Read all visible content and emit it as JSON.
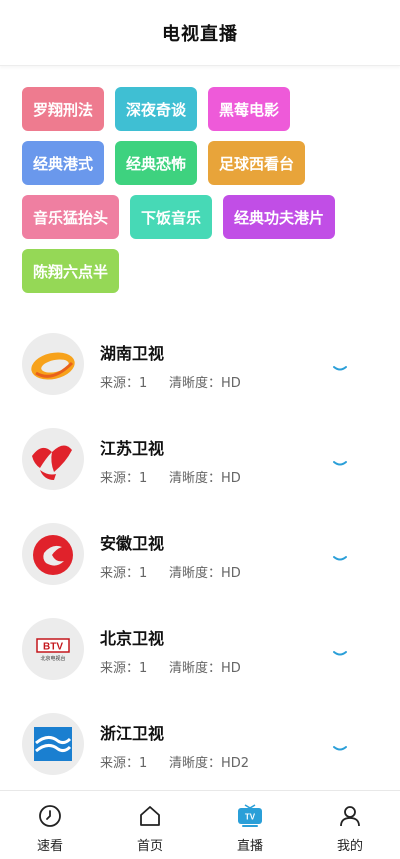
{
  "header": {
    "title": "电视直播"
  },
  "tags": [
    {
      "label": "罗翔刑法",
      "color": "#ee7b8f"
    },
    {
      "label": "深夜奇谈",
      "color": "#3fbfd3"
    },
    {
      "label": "黑莓电影",
      "color": "#ee5ad9"
    },
    {
      "label": "经典港式",
      "color": "#6a98ec"
    },
    {
      "label": "经典恐怖",
      "color": "#3ed27f"
    },
    {
      "label": "足球西看台",
      "color": "#e8a43a"
    },
    {
      "label": "音乐猛抬头",
      "color": "#ef7fa1"
    },
    {
      "label": "下饭音乐",
      "color": "#47d9b6"
    },
    {
      "label": "经典功夫港片",
      "color": "#c14ee6"
    },
    {
      "label": "陈翔六点半",
      "color": "#95d856"
    }
  ],
  "channels": [
    {
      "name": "湖南卫视",
      "source": "来源：1",
      "clarity": "清晰度：HD",
      "logo": "hunan-logo-icon"
    },
    {
      "name": "江苏卫视",
      "source": "来源：1",
      "clarity": "清晰度：HD",
      "logo": "jiangsu-logo-icon"
    },
    {
      "name": "安徽卫视",
      "source": "来源：1",
      "clarity": "清晰度：HD",
      "logo": "anhui-logo-icon"
    },
    {
      "name": "北京卫视",
      "source": "来源：1",
      "clarity": "清晰度：HD",
      "logo": "btv-logo-icon",
      "logo_text": "BTV",
      "logo_subtext": "北京电视台"
    },
    {
      "name": "浙江卫视",
      "source": "来源：1",
      "clarity": "清晰度：HD2",
      "logo": "zhejiang-logo-icon"
    }
  ],
  "tabbar": {
    "tabs": [
      {
        "label": "速看",
        "icon": "clock-icon"
      },
      {
        "label": "首页",
        "icon": "home-icon"
      },
      {
        "label": "直播",
        "icon": "tv-icon",
        "active": true
      },
      {
        "label": "我的",
        "icon": "user-icon"
      }
    ],
    "accent": "#2a9fd8"
  }
}
